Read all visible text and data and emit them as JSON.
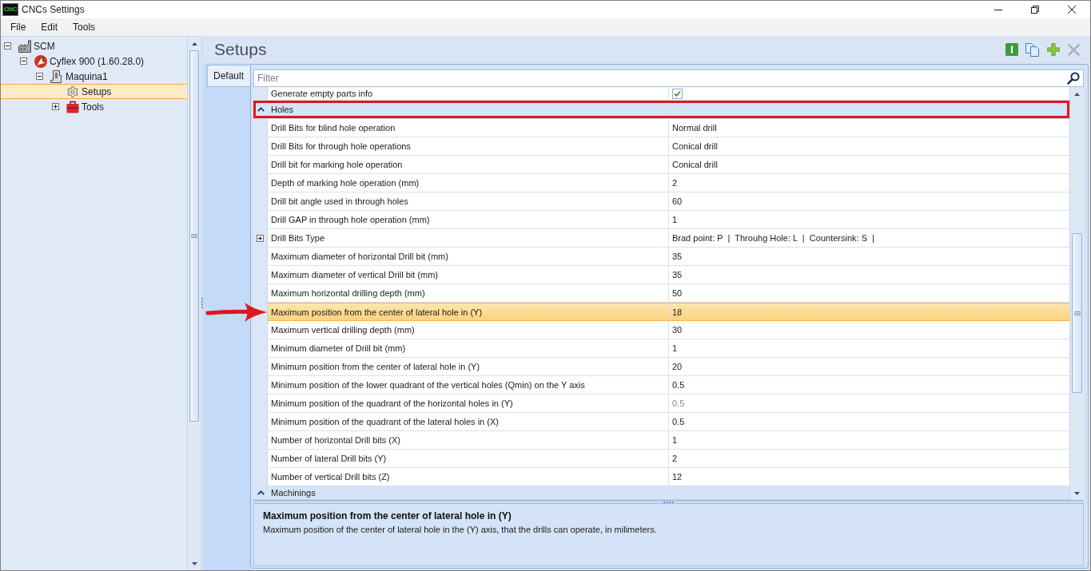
{
  "window": {
    "title": "CNCs Settings",
    "icon_label": "CNC"
  },
  "menu": [
    "File",
    "Edit",
    "Tools"
  ],
  "tree": [
    {
      "label": "SCM",
      "kind": "factory",
      "expanded": true,
      "selected": false,
      "children": [
        {
          "label": "Cyflex 900 (1.60.28.0)",
          "kind": "brand",
          "expanded": true,
          "selected": false,
          "children": [
            {
              "label": "Maquina1",
              "kind": "machine",
              "expanded": true,
              "selected": false,
              "children": [
                {
                  "label": "Setups",
                  "kind": "settings",
                  "selected": true
                },
                {
                  "label": "Tools",
                  "kind": "toolbox",
                  "expanded": false,
                  "selected": false
                }
              ]
            }
          ]
        }
      ]
    }
  ],
  "panel": {
    "title": "Setups",
    "toolbar": [
      {
        "kind": "info",
        "disabled": false
      },
      {
        "kind": "copy",
        "disabled": false
      },
      {
        "kind": "add",
        "disabled": false
      },
      {
        "kind": "delete",
        "disabled": true
      }
    ]
  },
  "tabs": [
    {
      "label": "Default",
      "selected": true
    }
  ],
  "property_grid": {
    "filter": {
      "placeholder": "Filter"
    },
    "rows": [
      {
        "kind": "checkbox",
        "name": "Generate empty parts info",
        "checked": true,
        "selected": false,
        "disabled": false,
        "framed": false,
        "pointed": false
      },
      {
        "kind": "category",
        "name": "Holes",
        "expanded": true,
        "selected": false,
        "framed": true,
        "pointed": false
      },
      {
        "kind": "text",
        "name": "Drill Bits for blind hole operation",
        "value": "Normal drill",
        "selected": false,
        "disabled": false,
        "framed": false,
        "pointed": false
      },
      {
        "kind": "text",
        "name": "Drill Bits for through hole operations",
        "value": "Conical drill",
        "selected": false,
        "disabled": false,
        "framed": false,
        "pointed": false
      },
      {
        "kind": "text",
        "name": "Drill bit for marking hole operation",
        "value": "Conical drill",
        "selected": false,
        "disabled": false,
        "framed": false,
        "pointed": false
      },
      {
        "kind": "text",
        "name": "Depth of marking hole operation (mm)",
        "value": "2",
        "selected": false,
        "disabled": false,
        "framed": false,
        "pointed": false
      },
      {
        "kind": "text",
        "name": "Drill bit angle used in through holes",
        "value": "60",
        "selected": false,
        "disabled": false,
        "framed": false,
        "pointed": false
      },
      {
        "kind": "text",
        "name": "Drill GAP in through hole operation (mm)",
        "value": "1",
        "selected": false,
        "disabled": false,
        "framed": false,
        "pointed": false
      },
      {
        "kind": "group",
        "name": "Drill Bits Type",
        "value": "Brad point: P  |  Throuhg Hole: L  |  Countersink: S  |",
        "expanded": false,
        "selected": false,
        "disabled": false,
        "framed": false,
        "pointed": false
      },
      {
        "kind": "text",
        "name": "Maximum diameter of horizontal Drill bit (mm)",
        "value": "35",
        "selected": false,
        "disabled": false,
        "framed": false,
        "pointed": false
      },
      {
        "kind": "text",
        "name": "Maximum diameter of vertical Drill bit (mm)",
        "value": "35",
        "selected": false,
        "disabled": false,
        "framed": false,
        "pointed": false
      },
      {
        "kind": "text",
        "name": "Maximum horizontal drilling depth (mm)",
        "value": "50",
        "selected": false,
        "disabled": false,
        "framed": false,
        "pointed": false
      },
      {
        "kind": "text",
        "name": "Maximum position from the center of lateral hole in (Y)",
        "value": "18",
        "selected": true,
        "disabled": false,
        "framed": false,
        "pointed": true
      },
      {
        "kind": "text",
        "name": "Maximum vertical drilling depth (mm)",
        "value": "30",
        "selected": false,
        "disabled": false,
        "framed": false,
        "pointed": false
      },
      {
        "kind": "text",
        "name": "Minimum diameter of Drill bit (mm)",
        "value": "1",
        "selected": false,
        "disabled": false,
        "framed": false,
        "pointed": false
      },
      {
        "kind": "text",
        "name": "Minimum position from the center of lateral hole in (Y)",
        "value": "20",
        "selected": false,
        "disabled": false,
        "framed": false,
        "pointed": false
      },
      {
        "kind": "text",
        "name": "Minimum position of the lower quadrant of the vertical holes (Qmin) on the Y axis",
        "value": "0.5",
        "selected": false,
        "disabled": false,
        "framed": false,
        "pointed": false
      },
      {
        "kind": "text",
        "name": "Minimum position of the quadrant of the horizontal holes in (Y)",
        "value": "0.5",
        "selected": false,
        "disabled": true,
        "framed": false,
        "pointed": false
      },
      {
        "kind": "text",
        "name": "Minimum position of the quadrant of the lateral holes in (X)",
        "value": "0.5",
        "selected": false,
        "disabled": false,
        "framed": false,
        "pointed": false
      },
      {
        "kind": "text",
        "name": "Number of horizontal Drill bits (X)",
        "value": "1",
        "selected": false,
        "disabled": false,
        "framed": false,
        "pointed": false
      },
      {
        "kind": "text",
        "name": "Number of lateral Drill bits (Y)",
        "value": "2",
        "selected": false,
        "disabled": false,
        "framed": false,
        "pointed": false
      },
      {
        "kind": "text",
        "name": "Number of vertical Drill bits (Z)",
        "value": "12",
        "selected": false,
        "disabled": false,
        "framed": false,
        "pointed": false
      },
      {
        "kind": "category",
        "name": "Machinings",
        "expanded": true,
        "selected": false,
        "framed": false,
        "pointed": false
      }
    ]
  },
  "description": {
    "title": "Maximum position from the center of lateral hole in (Y)",
    "text": "Maximum position of the center of lateral hole in the (Y) axis, that the drills can operate, in milimeters."
  }
}
